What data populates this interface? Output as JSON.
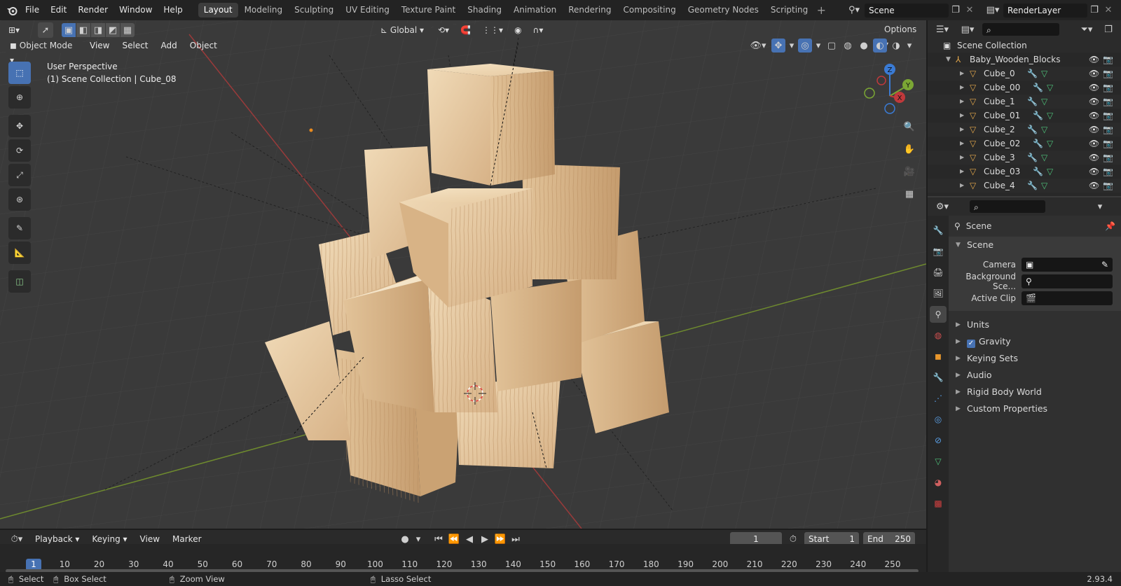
{
  "topbar": {
    "menus": [
      "File",
      "Edit",
      "Render",
      "Window",
      "Help"
    ],
    "workspaces": [
      "Layout",
      "Modeling",
      "Sculpting",
      "UV Editing",
      "Texture Paint",
      "Shading",
      "Animation",
      "Rendering",
      "Compositing",
      "Geometry Nodes",
      "Scripting"
    ],
    "active_workspace": "Layout",
    "scene_name": "Scene",
    "view_layer": "RenderLayer"
  },
  "viewport": {
    "transform_orientation": "Global",
    "options_label": "Options",
    "mode": "Object Mode",
    "menus": [
      "View",
      "Select",
      "Add",
      "Object"
    ],
    "perspective_label": "User Perspective",
    "context_label": "(1) Scene Collection | Cube_08",
    "gizmo_axes": {
      "x": "X",
      "y": "Y",
      "z": "Z"
    }
  },
  "outliner": {
    "root": "Scene Collection",
    "collection": "Baby_Wooden_Blocks",
    "objects": [
      "Cube_0",
      "Cube_00",
      "Cube_1",
      "Cube_01",
      "Cube_2",
      "Cube_02",
      "Cube_3",
      "Cube_03",
      "Cube_4"
    ]
  },
  "properties": {
    "context": "Scene",
    "panel": "Scene",
    "camera_label": "Camera",
    "background_label": "Background Sce...",
    "clip_label": "Active Clip",
    "sections": [
      "Units",
      "Gravity",
      "Keying Sets",
      "Audio",
      "Rigid Body World",
      "Custom Properties"
    ],
    "gravity_enabled": true
  },
  "timeline": {
    "menus": [
      "Playback",
      "Keying",
      "View",
      "Marker"
    ],
    "current_frame": "1",
    "start_label": "Start",
    "start_value": "1",
    "end_label": "End",
    "end_value": "250",
    "ticks": [
      "1",
      "10",
      "20",
      "30",
      "40",
      "50",
      "60",
      "70",
      "80",
      "90",
      "100",
      "110",
      "120",
      "130",
      "140",
      "150",
      "160",
      "170",
      "180",
      "190",
      "200",
      "210",
      "220",
      "230",
      "240",
      "250"
    ]
  },
  "statusbar": {
    "select": "Select",
    "box_select": "Box Select",
    "zoom_view": "Zoom View",
    "lasso_select": "Lasso Select",
    "version": "2.93.4"
  },
  "colors": {
    "accent": "#4772b3",
    "x_axis": "#c0393b",
    "y_axis": "#7ba634",
    "z_axis": "#3a7bd5",
    "wood_light": "#ecd3ac",
    "wood_dark": "#c9a277"
  }
}
